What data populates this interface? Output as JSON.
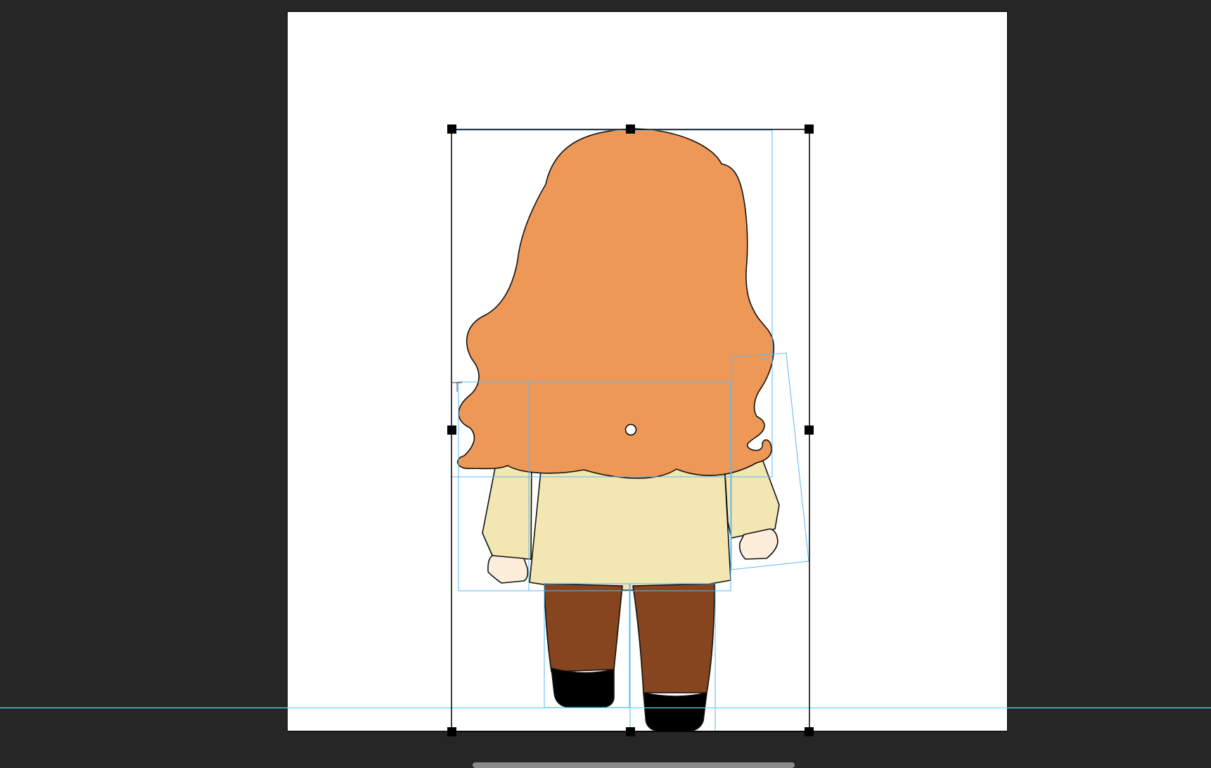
{
  "app": {
    "canvas_background": "#ffffff",
    "workspace_background": "#262626"
  },
  "colors": {
    "hair": "#EE9858",
    "shirt": "#F2E6B3",
    "skin": "#FDEEDB",
    "pants": "#87451F",
    "shoes": "#000000",
    "layer_bounds": "#5DB7F0",
    "guide": "#6FD8F0",
    "transform_handle": "#000000"
  },
  "icons": {
    "transform_handle": "square-handle-icon",
    "pivot": "pivot-circle-icon",
    "cursor": "crosshair-cursor-icon"
  },
  "tool": {
    "mode": "free-transform"
  }
}
